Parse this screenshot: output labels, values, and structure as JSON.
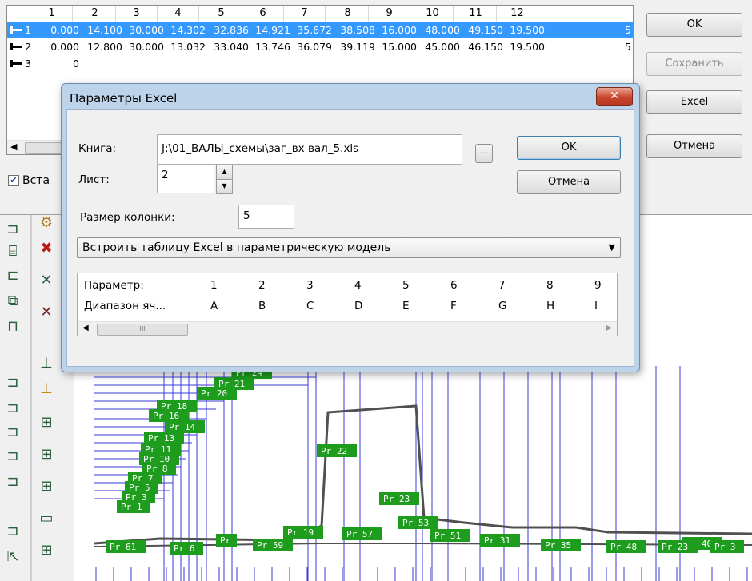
{
  "back_table": {
    "column_headers": [
      "1",
      "2",
      "3",
      "4",
      "5",
      "6",
      "7",
      "8",
      "9",
      "10",
      "11",
      "12"
    ],
    "rows": [
      {
        "num": "1",
        "selected": true,
        "cells": [
          "0.000",
          "14.100",
          "30.000",
          "14.302",
          "32.836",
          "14.921",
          "35.672",
          "38.508",
          "16.000",
          "48.000",
          "49.150",
          "19.500"
        ],
        "trail": "5"
      },
      {
        "num": "2",
        "selected": false,
        "cells": [
          "0.000",
          "12.800",
          "30.000",
          "13.032",
          "33.040",
          "13.746",
          "36.079",
          "39.119",
          "15.000",
          "45.000",
          "46.150",
          "19.500"
        ],
        "trail": "5"
      },
      {
        "num": "3",
        "selected": false,
        "cells": [
          "0",
          "",
          "",
          "",
          "",
          "",
          "",
          "",
          "",
          "",
          "",
          ""
        ],
        "trail": ""
      }
    ],
    "checkbox_label": "Вста",
    "checkbox_checked": true
  },
  "side_buttons": {
    "ok": "OK",
    "save": "Сохранить",
    "excel": "Excel",
    "cancel": "Отмена"
  },
  "dialog": {
    "title": "Параметры Excel",
    "close_glyph": "✕",
    "book_label": "Книга:",
    "book_value": "J:\\01_ВАЛЫ_схемы\\заг_вх вал_5.xls",
    "browse_label": "...",
    "ok_label": "OK",
    "cancel_label": "Отмена",
    "sheet_label": "Лист:",
    "sheet_value": "2",
    "column_size_label": "Размер колонки:",
    "column_size_value": "5",
    "mode_value": "Встроить таблицу Excel в параметрическую модель",
    "param_table": {
      "header": [
        "Параметр:",
        "1",
        "2",
        "3",
        "4",
        "5",
        "6",
        "7",
        "8",
        "9"
      ],
      "row": [
        "Диапазон яч...",
        "A",
        "B",
        "C",
        "D",
        "E",
        "F",
        "G",
        "H",
        "I"
      ]
    },
    "scroll_grip": "III"
  },
  "drawing": {
    "labels_visible": [
      "Pr 24",
      "Pr 21",
      "Pr 20",
      "Pr 18",
      "Pr 16",
      "Pr 14",
      "Pr 13",
      "Pr 11",
      "Pr 10",
      "Pr 8",
      "Pr 7",
      "Pr 5",
      "Pr 3",
      "Pr 1",
      "Pr 22",
      "Pr 23",
      "Pr 19",
      "Pr 57",
      "Pr 53",
      "Pr 51",
      "Pr 35",
      "Pr 31",
      "Pr 48",
      "Pr 40",
      "Pr 61",
      "Pr 6",
      "Pr 59",
      "Pr 23",
      "Pr 3",
      "Pr"
    ],
    "label_color": "#1d9c1d",
    "line_color": "#3a3ad8",
    "contour_color": "#505050"
  },
  "colors": {
    "selection": "#3399ff",
    "title_bar": "#bcd3ea",
    "close": "#c7442b"
  }
}
